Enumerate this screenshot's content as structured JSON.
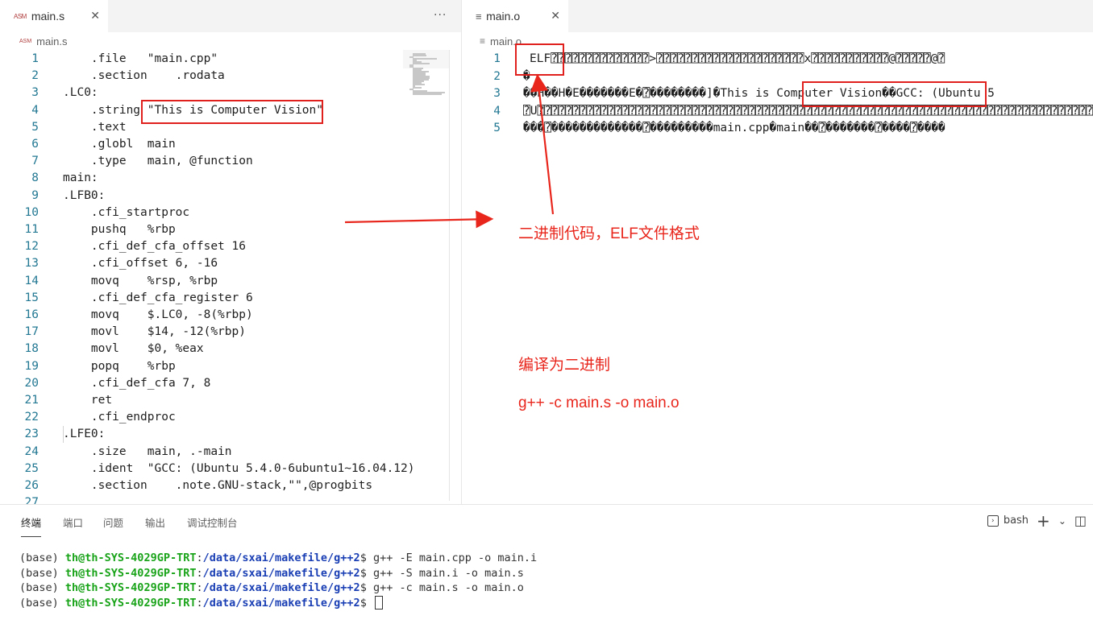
{
  "left_editor": {
    "tab_icon": "ASM",
    "tab_label": "main.s",
    "close_icon": "✕",
    "more_actions": "···",
    "breadcrumb_icon": "ASM",
    "breadcrumb_label": "main.s",
    "lines": [
      {
        "n": "1",
        "text": "    .file   \"main.cpp\""
      },
      {
        "n": "2",
        "text": "    .section    .rodata"
      },
      {
        "n": "3",
        "text": ".LC0:"
      },
      {
        "n": "4",
        "text": "    .string \"This is Computer Vision\""
      },
      {
        "n": "5",
        "text": "    .text"
      },
      {
        "n": "6",
        "text": "    .globl  main"
      },
      {
        "n": "7",
        "text": "    .type   main, @function"
      },
      {
        "n": "8",
        "text": "main:"
      },
      {
        "n": "9",
        "text": ".LFB0:"
      },
      {
        "n": "10",
        "text": "    .cfi_startproc"
      },
      {
        "n": "11",
        "text": "    pushq   %rbp"
      },
      {
        "n": "12",
        "text": "    .cfi_def_cfa_offset 16"
      },
      {
        "n": "13",
        "text": "    .cfi_offset 6, -16"
      },
      {
        "n": "14",
        "text": "    movq    %rsp, %rbp"
      },
      {
        "n": "15",
        "text": "    .cfi_def_cfa_register 6"
      },
      {
        "n": "16",
        "text": "    movq    $.LC0, -8(%rbp)"
      },
      {
        "n": "17",
        "text": "    movl    $14, -12(%rbp)"
      },
      {
        "n": "18",
        "text": "    movl    $0, %eax"
      },
      {
        "n": "19",
        "text": "    popq    %rbp"
      },
      {
        "n": "20",
        "text": "    .cfi_def_cfa 7, 8"
      },
      {
        "n": "21",
        "text": "    ret"
      },
      {
        "n": "22",
        "text": "    .cfi_endproc"
      },
      {
        "n": "23",
        "text": ".LFE0:"
      },
      {
        "n": "24",
        "text": "    .size   main, .-main"
      },
      {
        "n": "25",
        "text": "    .ident  \"GCC: (Ubuntu 5.4.0-6ubuntu1~16.04.12)"
      },
      {
        "n": "26",
        "text": "    .section    .note.GNU-stack,\"\",@progbits"
      },
      {
        "n": "27",
        "text": ""
      }
    ]
  },
  "right_editor": {
    "tab_icon": "≡",
    "tab_label": "main.o",
    "close_icon": "✕",
    "breadcrumb_icon": "≡",
    "breadcrumb_label": "main.o",
    "lines": [
      {
        "n": "1",
        "text": "ELF⍰⍰⍰⍰⍰⍰⍰⍰⍰⍰⍰⍰⍰⍰>⍰⍰⍰⍰⍰⍰⍰⍰⍰⍰⍰⍰⍰⍰⍰⍰⍰⍰⍰⍰⍰x⍰⍰⍰⍰⍰⍰⍰⍰⍰⍰⍰@⍰⍰⍰⍰⍰@⍰"
      },
      {
        "n": "2",
        "text": "�"
      },
      {
        "n": "3",
        "text": "��H��H�E�������E�⍰��������]�This is Computer Vision��GCC: (Ubuntu 5"
      },
      {
        "n": "4",
        "text": "⍰U⍰⍰⍰⍰⍰⍰⍰⍰⍰⍰⍰⍰⍰⍰⍰⍰⍰⍰⍰⍰⍰⍰⍰⍰⍰⍰⍰⍰⍰⍰⍰⍰⍰⍰⍰⍰⍰⍰⍰⍰⍰⍰⍰⍰⍰⍰⍰⍰⍰⍰⍰⍰⍰⍰⍰⍰⍰⍰⍰⍰⍰⍰⍰⍰⍰⍰⍰⍰⍰⍰⍰⍰⍰⍰⍰⍰⍰⍰⍰⍰⍰⍰⍰⍰⍰⍰"
      },
      {
        "n": "5",
        "text": "���⍰�������������⍰���������main.cpp�main��⍰�������⍰����⍰����"
      }
    ]
  },
  "annotations": {
    "label_elf": "二进制代码，ELF文件格式",
    "label_compile": "编译为二进制",
    "label_command": "g++ -c main.s -o main.o",
    "color": "#e8261c"
  },
  "panel": {
    "tabs": [
      "终端",
      "端口",
      "问题",
      "输出",
      "调试控制台"
    ],
    "active_tab": "终端",
    "shell_label": "bash",
    "add_icon": "+",
    "chevron_icon": "⌄",
    "split_icon": "◫"
  },
  "terminal": {
    "lines": [
      {
        "base": "(base) ",
        "user": "th@th-SYS-4029GP-TRT",
        "sep": ":",
        "path": "/data/sxai/makefile/g++2",
        "prompt": "$ ",
        "cmd": "g++ -E main.cpp -o main.i"
      },
      {
        "base": "(base) ",
        "user": "th@th-SYS-4029GP-TRT",
        "sep": ":",
        "path": "/data/sxai/makefile/g++2",
        "prompt": "$ ",
        "cmd": "g++ -S main.i -o main.s"
      },
      {
        "base": "(base) ",
        "user": "th@th-SYS-4029GP-TRT",
        "sep": ":",
        "path": "/data/sxai/makefile/g++2",
        "prompt": "$ ",
        "cmd": "g++ -c main.s -o main.o"
      },
      {
        "base": "(base) ",
        "user": "th@th-SYS-4029GP-TRT",
        "sep": ":",
        "path": "/data/sxai/makefile/g++2",
        "prompt": "$ ",
        "cmd": ""
      }
    ]
  }
}
